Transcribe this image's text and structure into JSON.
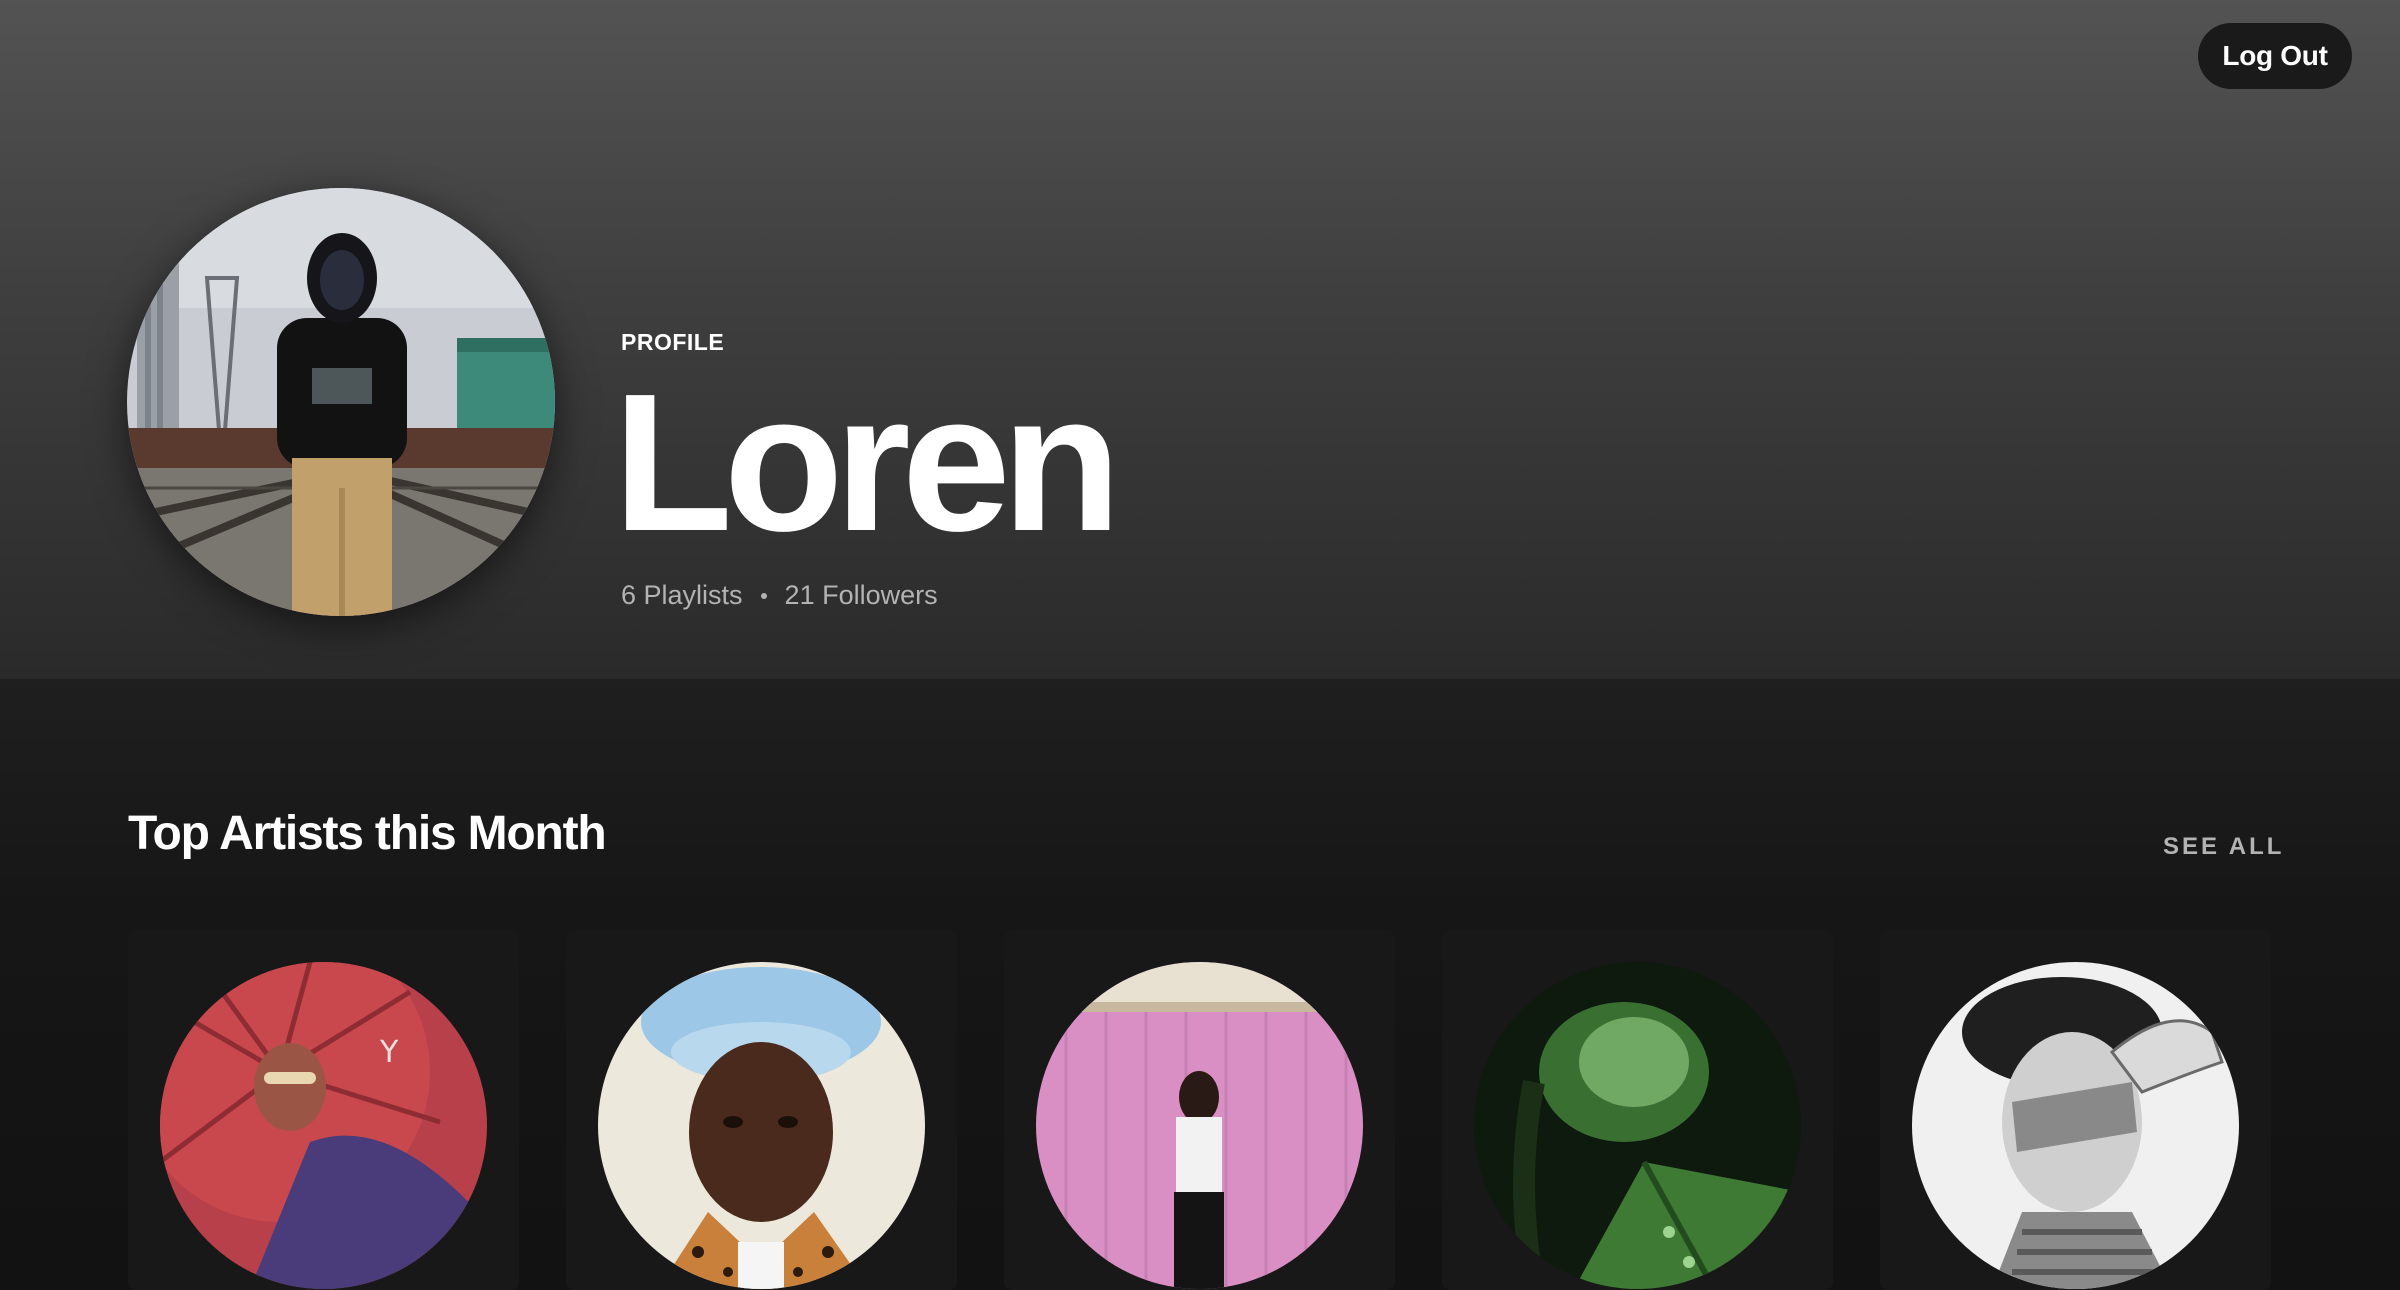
{
  "header": {
    "logout_label": "Log Out",
    "profile_label": "PROFILE",
    "name": "Loren",
    "stats": {
      "playlists": "6 Playlists",
      "followers": "21 Followers"
    }
  },
  "top_artists": {
    "title": "Top Artists this Month",
    "see_all_label": "SEE ALL",
    "artists": [
      {
        "image": "artist-red-umbrella-photo"
      },
      {
        "image": "artist-blue-hat-photo"
      },
      {
        "image": "artist-pink-wall-photo"
      },
      {
        "image": "artist-green-tint-photo"
      },
      {
        "image": "artist-black-white-photo"
      }
    ]
  },
  "colors": {
    "background": "#121212",
    "header_gradient_top": "#535353",
    "card_bg": "#181818",
    "muted_text": "#b3b3b3"
  }
}
